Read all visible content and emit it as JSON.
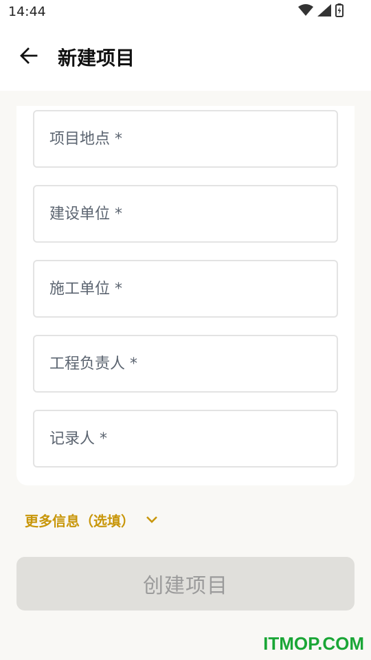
{
  "status_bar": {
    "time": "14:44",
    "icons": [
      "wifi-icon",
      "signal-icon",
      "battery-charging-icon"
    ]
  },
  "app_bar": {
    "back_icon": "arrow-left-icon",
    "title": "新建项目"
  },
  "form": {
    "fields": [
      {
        "placeholder": "项目地点 *",
        "value": ""
      },
      {
        "placeholder": "建设单位 *",
        "value": ""
      },
      {
        "placeholder": "施工单位 *",
        "value": ""
      },
      {
        "placeholder": "工程负责人 *",
        "value": ""
      },
      {
        "placeholder": "记录人 *",
        "value": ""
      }
    ]
  },
  "more_info": {
    "label": "更多信息（选填）",
    "icon": "chevron-down-icon"
  },
  "actions": {
    "create_label": "创建项目"
  },
  "watermark": {
    "text": "ITMOP.COM"
  },
  "colors": {
    "accent": "#c8960a",
    "background": "#f9f8f5",
    "button_disabled_bg": "#e0dfdb",
    "button_disabled_text": "#9b9b9b",
    "watermark": "#1aa636"
  }
}
